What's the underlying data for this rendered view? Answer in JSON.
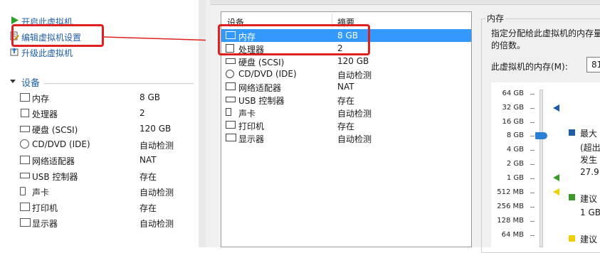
{
  "left_panel": {
    "commands": [
      {
        "label": "开启此虚拟机",
        "icon": "play-icon"
      },
      {
        "label": "编辑虚拟机设置",
        "icon": "edit-settings-icon"
      },
      {
        "label": "升级此虚拟机",
        "icon": "upgrade-icon"
      }
    ],
    "devices_section_title": "设备",
    "devices": [
      {
        "name": "内存",
        "value": "8 GB",
        "icon": "memory-icon"
      },
      {
        "name": "处理器",
        "value": "2",
        "icon": "processor-icon"
      },
      {
        "name": "硬盘 (SCSI)",
        "value": "120 GB",
        "icon": "hard-disk-icon"
      },
      {
        "name": "CD/DVD (IDE)",
        "value": "自动检测",
        "icon": "cd-dvd-icon"
      },
      {
        "name": "网络适配器",
        "value": "NAT",
        "icon": "network-adapter-icon"
      },
      {
        "name": "USB 控制器",
        "value": "存在",
        "icon": "usb-icon"
      },
      {
        "name": "声卡",
        "value": "自动检测",
        "icon": "speaker-icon"
      },
      {
        "name": "打印机",
        "value": "存在",
        "icon": "printer-icon"
      },
      {
        "name": "显示器",
        "value": "自动检测",
        "icon": "monitor-icon"
      }
    ]
  },
  "dialog": {
    "device_list": {
      "col_device": "设备",
      "col_summary": "摘要",
      "selected_index": 0,
      "rows": [
        {
          "name": "内存",
          "value": "8 GB",
          "icon": "memory-icon"
        },
        {
          "name": "处理器",
          "value": "2",
          "icon": "processor-icon"
        },
        {
          "name": "硬盘 (SCSI)",
          "value": "120 GB",
          "icon": "hard-disk-icon"
        },
        {
          "name": "CD/DVD (IDE)",
          "value": "自动检测",
          "icon": "cd-dvd-icon"
        },
        {
          "name": "网络适配器",
          "value": "NAT",
          "icon": "network-adapter-icon"
        },
        {
          "name": "USB 控制器",
          "value": "存在",
          "icon": "usb-icon"
        },
        {
          "name": "声卡",
          "value": "自动检测",
          "icon": "speaker-icon"
        },
        {
          "name": "打印机",
          "value": "存在",
          "icon": "printer-icon"
        },
        {
          "name": "显示器",
          "value": "自动检测",
          "icon": "monitor-icon"
        }
      ]
    },
    "memory_panel": {
      "group_title": "内存",
      "desc_line1": "指定分配给此虚拟机的内存量",
      "desc_line2": "的倍数。",
      "memory_label": "此虚拟机的内存(M):",
      "memory_value": "81",
      "scale_labels": [
        "64 GB",
        "32 GB",
        "16 GB",
        "8 GB",
        "4 GB",
        "2 GB",
        "1 GB",
        "512 MB",
        "256 MB",
        "128 MB",
        "64 MB"
      ],
      "legend_max_title": "最大",
      "legend_max_line1": "(超出",
      "legend_max_line2": "发生",
      "legend_max_value": "27.9",
      "legend_rec_title": "建议",
      "legend_rec_value": "1 GB",
      "legend_min_title": "建议",
      "colors": {
        "max": "#1c5ea8",
        "recommended": "#3a9a2a",
        "guest_min": "#f0d000",
        "selection": "#3399ff",
        "annotation": "#e02020"
      }
    }
  }
}
